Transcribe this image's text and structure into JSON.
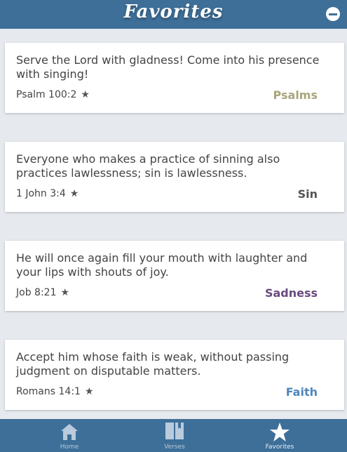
{
  "header": {
    "title": "Favorites",
    "remove_icon": "minus-circle-icon"
  },
  "favorites": [
    {
      "verse": "Serve the Lord with gladness! Come into his presence with singing!",
      "reference": "Psalm 100:2",
      "star": "★",
      "topic": "Psalms",
      "topic_color": "#a9a57c"
    },
    {
      "verse": "Everyone who makes a practice of sinning also practices lawlessness; sin is lawlessness.",
      "reference": "1 John 3:4",
      "star": "★",
      "topic": "Sin",
      "topic_color": "#555555"
    },
    {
      "verse": "He will once again fill your mouth with laughter and your lips with shouts of joy.",
      "reference": "Job 8:21",
      "star": "★",
      "topic": "Sadness",
      "topic_color": "#6a4a7f"
    },
    {
      "verse": "Accept him whose faith is weak, without passing judgment on disputable matters.",
      "reference": "Romans 14:1",
      "star": "★",
      "topic": "Faith",
      "topic_color": "#4f88bb"
    }
  ],
  "tabs": [
    {
      "label": "Home",
      "icon": "home-icon"
    },
    {
      "label": "Verses",
      "icon": "book-icon"
    },
    {
      "label": "Favorites",
      "icon": "star-icon"
    }
  ]
}
